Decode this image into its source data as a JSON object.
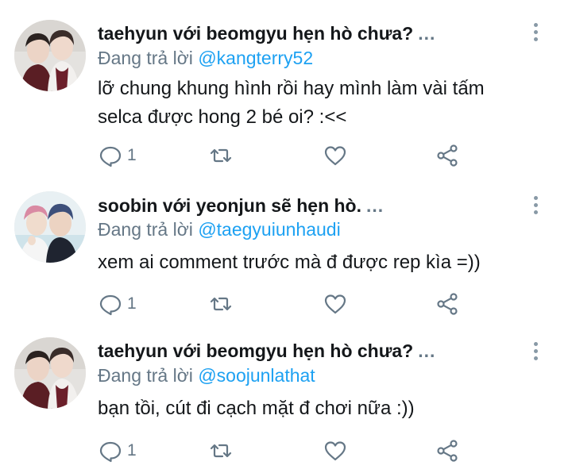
{
  "tweets": [
    {
      "author": "taehyun với beomgyu hẹn hò chưa?",
      "more": "...",
      "reply_prefix": "Đang trả lời",
      "reply_handle": "@kangterry52",
      "text_line1": "lỡ chung khung hình rồi hay mình làm vài tấm",
      "text_line2": "selca được hong 2 bé oi? :<<",
      "reply_count": "1"
    },
    {
      "author": "soobin với yeonjun sẽ hẹn hò.",
      "more": "...",
      "reply_prefix": "Đang trả lời",
      "reply_handle": "@taegyuiunhaudi",
      "text_line1": "xem ai comment trước mà đ được rep kìa =))",
      "reply_count": "1"
    },
    {
      "author": "taehyun với beomgyu hẹn hò chưa?",
      "more": "...",
      "reply_prefix": "Đang trả lời",
      "reply_handle": "@soojunlathat",
      "text_line1": "bạn tồi, cút đi cạch mặt đ chơi nữa :))",
      "reply_count": "1"
    }
  ],
  "icons": {
    "reply": "speech-bubble-icon",
    "retweet": "retweet-icon",
    "like": "heart-icon",
    "share": "share-icon",
    "menu": "vertical-dots-icon"
  },
  "colors": {
    "text": "#14171a",
    "secondary": "#657786",
    "link": "#1da1f2",
    "icon": "#657786"
  }
}
